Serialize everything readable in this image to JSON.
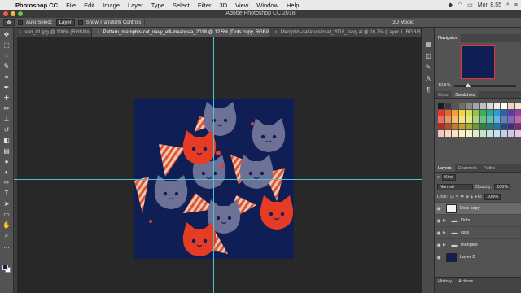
{
  "menubar": {
    "app_name": "Photoshop CC",
    "items": [
      "File",
      "Edit",
      "Image",
      "Layer",
      "Type",
      "Select",
      "Filter",
      "3D",
      "View",
      "Window",
      "Help"
    ],
    "clock": "Mon 8.55"
  },
  "window_title": "Adobe Photoshop CC 2018",
  "options": {
    "auto_select_label": "Auto-Select:",
    "auto_select_value": "Layer",
    "transform_label": "Show Transform Controls",
    "mode_label": "3D Mode:"
  },
  "tabs": [
    {
      "label": "vari_01.jpg @ 100% (RGB/8#)"
    },
    {
      "label": "Pattern_memphis-cat_navy_elli-maanpaa_2018 @ 12,5% (Dots copy, RGB/8) *"
    },
    {
      "label": "Memphis-cat-kuosiosat_2018_navy.ai @ 16,7% (Layer 1, RGB/8) *"
    }
  ],
  "navigator": {
    "tab": "Navigator",
    "zoom": "12,5%"
  },
  "swatches": {
    "tabs": [
      "Color",
      "Swatches"
    ],
    "colors": [
      "#1b1b1b",
      "#3a3a3a",
      "#555555",
      "#6f6f6f",
      "#8a8a8a",
      "#a5a5a5",
      "#c0c0c0",
      "#dadada",
      "#ececec",
      "#ffffff",
      "#f4d0c8",
      "#f1e6c8",
      "#e8362d",
      "#e8672a",
      "#f3a23a",
      "#f7d343",
      "#d8e04a",
      "#8fc64a",
      "#3eae5b",
      "#2aa89c",
      "#2a9fd6",
      "#2b62b5",
      "#5b3ea5",
      "#a43a9c",
      "#f06b60",
      "#f2915c",
      "#f6be6c",
      "#f9e079",
      "#e3ea7d",
      "#acd579",
      "#6cc184",
      "#5fbfb4",
      "#5db6e2",
      "#5a83c6",
      "#7f67ba",
      "#bd67b5",
      "#b8291f",
      "#b5511f",
      "#c07c27",
      "#c2a42d",
      "#a7ad34",
      "#6c9a35",
      "#2c8443",
      "#1f8077",
      "#1f78a5",
      "#1d4a8a",
      "#43297f",
      "#7f2877",
      "#f9c4be",
      "#f9d6bc",
      "#fbe3c2",
      "#fdf0c6",
      "#f2f5c6",
      "#dbeec5",
      "#c3e5cb",
      "#c1e4e0",
      "#c2e2f3",
      "#c3cfe8",
      "#d2c7e4",
      "#e6c6e2"
    ]
  },
  "layers": {
    "tabs": [
      "Layers",
      "Channels",
      "Paths"
    ],
    "kind": "Kind",
    "blend_mode": "Normal",
    "opacity_label": "Opacity:",
    "opacity": "100%",
    "lock_label": "Lock:",
    "fill_label": "Fill:",
    "fill": "100%",
    "items": [
      {
        "name": "Dots copy",
        "type": "layer",
        "selected": true
      },
      {
        "name": "Dots",
        "type": "group"
      },
      {
        "name": "cats",
        "type": "group"
      },
      {
        "name": "triangles",
        "type": "group"
      },
      {
        "name": "Layer 2",
        "type": "layer"
      }
    ]
  },
  "bottom_tabs": [
    "History",
    "Actions"
  ],
  "colors": {
    "navy": "#0f1f55",
    "cat_grey": "#6d7196",
    "cat_red": "#e63b24",
    "stripe_light": "#f0c7b4",
    "stripe_red": "#e0552f",
    "guide": "#49c5d6"
  }
}
